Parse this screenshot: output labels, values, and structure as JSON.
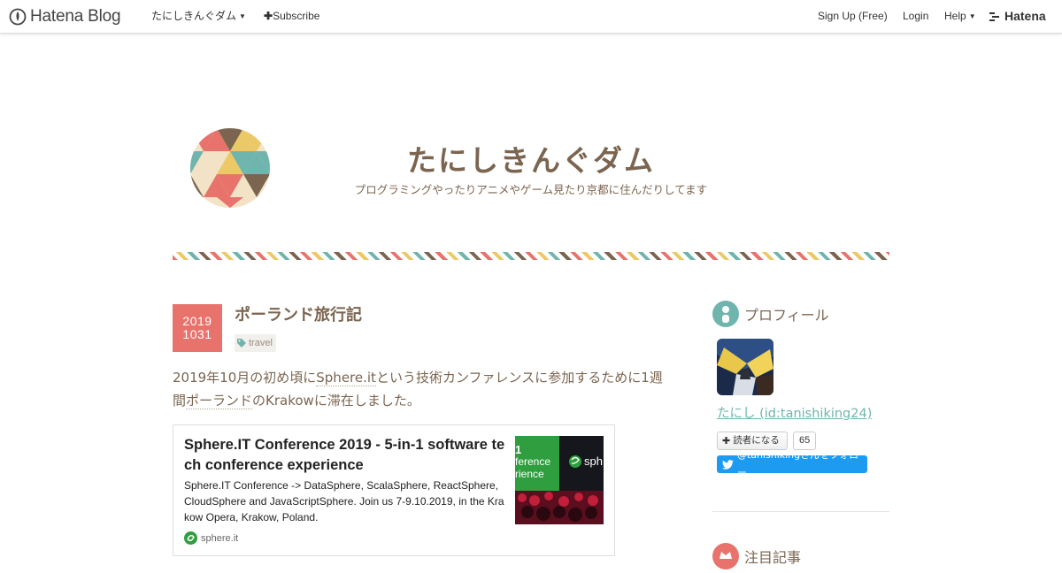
{
  "global_header": {
    "brand": "Hatena Blog",
    "blog_menu": "たにしきんぐダム",
    "subscribe": "Subscribe",
    "signup": "Sign Up (Free)",
    "login": "Login",
    "help": "Help",
    "hatena": "Hatena"
  },
  "blog": {
    "title": "たにしきんぐダム",
    "description": "プログラミングやったりアニメやゲーム見たり京都に住んだりしてます"
  },
  "entry": {
    "date_year": "2019",
    "date_monthday": "1031",
    "title": "ポーランド旅行記",
    "category": "travel",
    "body_1": "2019年10月の初め頃に",
    "body_kw1": "Sphere.it",
    "body_2": "という技術カンファレンスに参加するために1週間",
    "body_kw2": "ポーランド",
    "body_3": "のKrakowに滞在しました。"
  },
  "embed_card": {
    "title": "Sphere.IT Conference 2019 - 5-in-1 software tech conference experience",
    "description": "Sphere.IT Conference -> DataSphere, ScalaSphere, ReactSphere, CloudSphere and JavaScriptSphere. Join us 7-9.10.2019, in the Krakow Opera, Krakow, Poland.",
    "site": "sphere.it",
    "thumb_line1": "1",
    "thumb_line2": "ference",
    "thumb_line3": "rience",
    "thumb_brand": "sph"
  },
  "sidebar": {
    "profile_heading": "プロフィール",
    "profile_name": "たにし (id:tanishiking24)",
    "reader_button": "読者になる",
    "reader_count": "65",
    "follow_button": "@tanishikingさんをフォロー",
    "next_heading": "注目記事"
  },
  "colors": {
    "accent_red": "#e8736c",
    "accent_yellow": "#ecc866",
    "accent_teal": "#6fb5ad",
    "text_brown": "#7b6550",
    "twitter_blue": "#1d9bf0"
  }
}
